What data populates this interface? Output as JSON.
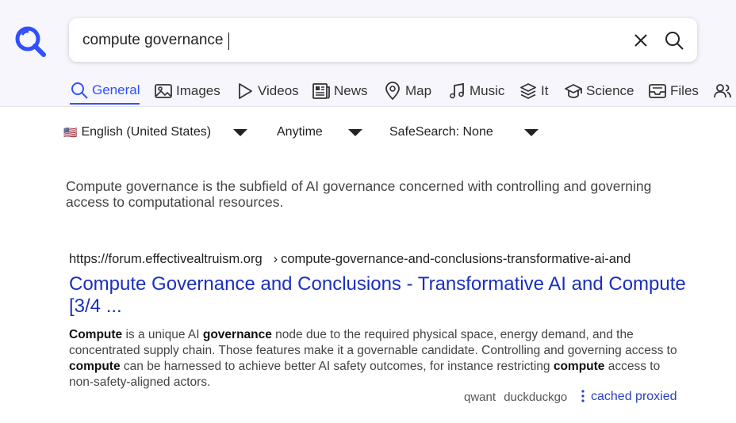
{
  "search": {
    "query": "compute governance",
    "clear_icon": "close-icon",
    "submit_icon": "search-icon"
  },
  "tabs": [
    {
      "label": "General",
      "icon": "search-icon",
      "active": true
    },
    {
      "label": "Images",
      "icon": "image-icon"
    },
    {
      "label": "Videos",
      "icon": "play-icon"
    },
    {
      "label": "News",
      "icon": "newspaper-icon"
    },
    {
      "label": "Map",
      "icon": "map-pin-icon"
    },
    {
      "label": "Music",
      "icon": "music-note-icon"
    },
    {
      "label": "It",
      "icon": "layers-icon"
    },
    {
      "label": "Science",
      "icon": "graduation-cap-icon"
    },
    {
      "label": "Files",
      "icon": "inbox-icon"
    },
    {
      "label": "",
      "icon": "users-icon"
    }
  ],
  "filters": {
    "language": "English (United States)",
    "language_flag": "🇺🇸",
    "time": "Anytime",
    "safesearch": "SafeSearch: None"
  },
  "answer": "Compute governance is the subfield of AI governance concerned with controlling and governing access to computational resources.",
  "results": [
    {
      "url_host": "https://forum.effectivealtruism.org",
      "url_path_sep": "›",
      "url_path": "compute-governance-and-conclusions-transformative-ai-and",
      "title": "Compute Governance and Conclusions - Transformative AI and Compute [3/4 ...",
      "snippet": [
        {
          "text": "Compute",
          "bold": true
        },
        {
          "text": " is a unique AI ",
          "bold": false
        },
        {
          "text": "governance",
          "bold": true
        },
        {
          "text": " node due to the required physical space, energy demand, and the concentrated supply chain. Those features make it a governable candidate. Controlling and governing access to ",
          "bold": false
        },
        {
          "text": "compute",
          "bold": true
        },
        {
          "text": " can be harnessed to achieve better AI safety outcomes, for instance restricting ",
          "bold": false
        },
        {
          "text": "compute",
          "bold": true
        },
        {
          "text": " access to non-safety-aligned actors.",
          "bold": false
        }
      ],
      "engines": [
        "qwant",
        "duckduckgo"
      ],
      "cached_label": "cached",
      "proxied_label": "proxied"
    }
  ],
  "colors": {
    "accent": "#3050ff",
    "link": "#1a2fbf",
    "header_bg": "#f7f6fd"
  }
}
